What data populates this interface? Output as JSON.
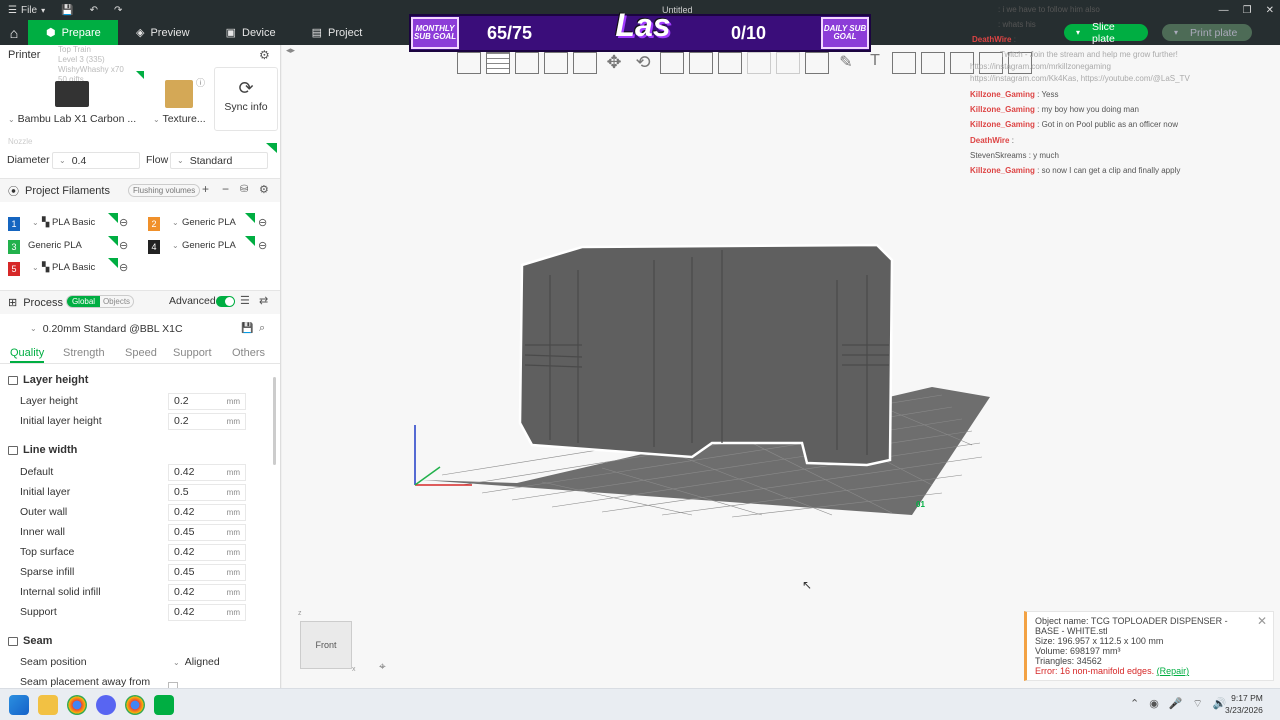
{
  "window": {
    "title": "Untitled",
    "file_menu": "File"
  },
  "nav": {
    "tabs": [
      {
        "label": "Prepare",
        "icon": "cube-icon"
      },
      {
        "label": "Preview",
        "icon": "layers-icon"
      },
      {
        "label": "Device",
        "icon": "device-icon"
      },
      {
        "label": "Project",
        "icon": "project-icon"
      }
    ],
    "slice_plate": "Slice plate",
    "print_plate": "Print plate"
  },
  "overlay": {
    "monthly_goal": "MONTHLY SUB GOAL",
    "monthly_count": "65/75",
    "logo": "Las",
    "daily_count": "0/10",
    "daily_goal": "DAILY SUB GOAL"
  },
  "printer": {
    "section_title": "Printer",
    "overlap_lines": [
      "Top Train",
      "Level 3 (335)",
      "WishyWhashy x70",
      "50 gifts"
    ],
    "model": "Bambu Lab X1 Carbon ...",
    "plate": "Texture...",
    "sync": "Sync info",
    "nozzle_label": "Nozzle",
    "diameter_label": "Diameter",
    "diameter_value": "0.4",
    "flow_label": "Flow",
    "flow_value": "Standard"
  },
  "filaments": {
    "title": "Project Filaments",
    "flushing": "Flushing volumes",
    "items": [
      {
        "num": "1",
        "color": "#1565c0",
        "name": "PLA Basic"
      },
      {
        "num": "2",
        "color": "#f0902a",
        "name": "Generic PLA"
      },
      {
        "num": "3",
        "color": "#22b14c",
        "name": "Generic PLA"
      },
      {
        "num": "4",
        "color": "#222222",
        "name": "Generic PLA"
      },
      {
        "num": "5",
        "color": "#d62828",
        "name": "PLA Basic"
      }
    ]
  },
  "process": {
    "title": "Process",
    "global": "Global",
    "objects": "Objects",
    "advanced": "Advanced",
    "preset": "0.20mm Standard @BBL X1C",
    "tabs": [
      "Quality",
      "Strength",
      "Speed",
      "Support",
      "Others"
    ],
    "groups": {
      "layer_height": "Layer height",
      "line_width": "Line width",
      "seam": "Seam"
    },
    "unit": "mm",
    "layer_params": [
      {
        "label": "Layer height",
        "value": "0.2"
      },
      {
        "label": "Initial layer height",
        "value": "0.2"
      }
    ],
    "line_params": [
      {
        "label": "Default",
        "value": "0.42"
      },
      {
        "label": "Initial layer",
        "value": "0.5"
      },
      {
        "label": "Outer wall",
        "value": "0.42"
      },
      {
        "label": "Inner wall",
        "value": "0.45"
      },
      {
        "label": "Top surface",
        "value": "0.42"
      },
      {
        "label": "Sparse infill",
        "value": "0.45"
      },
      {
        "label": "Internal solid infill",
        "value": "0.42"
      },
      {
        "label": "Support",
        "value": "0.42"
      }
    ],
    "seam_position_label": "Seam position",
    "seam_position_value": "Aligned",
    "seam_placement_label": "Seam placement away from"
  },
  "chat": [
    {
      "user": "",
      "text": ": i we have to follow him also"
    },
    {
      "user": "",
      "text": ": whats his"
    },
    {
      "user": "DeathWire",
      "text": ":"
    },
    {
      "user": "",
      "text": "Twitch - Join the stream and help me grow further!"
    },
    {
      "user": "",
      "text": "https://instagram.com/mrkillzonegaming"
    },
    {
      "user": "",
      "text": "https://instagram.com/Kk4Kas, https://youtube.com/@LaS_TV"
    },
    {
      "user": "Killzone_Gaming",
      "text": ": Yess"
    },
    {
      "user": "Killzone_Gaming",
      "text": ": my boy how you doing man"
    },
    {
      "user": "Killzone_Gaming",
      "text": ": Got in on Pool public as an officer now"
    },
    {
      "user": "DeathWire",
      "text": ":"
    },
    {
      "user": "StevenSkreams",
      "text": ": y much"
    },
    {
      "user": "Killzone_Gaming",
      "text": ": so now I can get a clip and finally apply"
    }
  ],
  "view_cube": {
    "label": "Front",
    "axis_x": "x",
    "axis_z": "z"
  },
  "plate_label": "01",
  "object_info": {
    "name": "Object name: TCG TOPLOADER DISPENSER - BASE - WHITE.stl",
    "size": "Size: 196.957 x 112.5 x 100 mm",
    "volume": "Volume: 698197 mm³",
    "triangles": "Triangles: 34562",
    "error": "Error: 16 non-manifold edges.",
    "repair": "(Repair)"
  },
  "taskbar": {
    "time": "9:17 PM",
    "date": "3/23/2026",
    "icons": [
      "windows-icon",
      "file-explorer-icon",
      "chrome-icon",
      "discord-icon",
      "chrome-icon",
      "bambu-studio-icon"
    ]
  }
}
